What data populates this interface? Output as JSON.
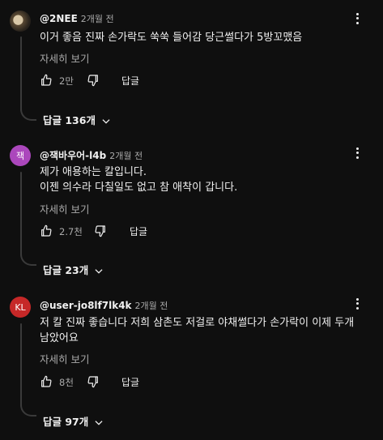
{
  "comments": [
    {
      "avatar_text": "",
      "handle": "@2NEE",
      "time": "2개월 전",
      "text": "이거 좋음 진짜 손가락도 쑥쑥 들어감 당근썰다가 5방꼬맸음",
      "more": "자세히 보기",
      "likes": "2만",
      "reply_label": "답글",
      "replies_toggle": "답글 136개"
    },
    {
      "avatar_text": "잭",
      "avatar_color": "#ab47bc",
      "handle": "@잭바우어-l4b",
      "time": "2개월 전",
      "text": "제가 애용하는 칼입니다.\n이젠 의수라 다칠일도 없고 참 애착이 갑니다.",
      "more": "자세히 보기",
      "likes": "2.7천",
      "reply_label": "답글",
      "replies_toggle": "답글 23개"
    },
    {
      "avatar_text": "KL",
      "avatar_color": "#c62828",
      "handle": "@user-jo8lf7lk4k",
      "time": "2개월 전",
      "text": "저 칼 진짜 좋습니다 저희 삼촌도 저걸로 야채썰다가 손가락이 이제 두개\n남았어요",
      "more": "자세히 보기",
      "likes": "8천",
      "reply_label": "답글",
      "replies_toggle": "답글 97개"
    }
  ]
}
